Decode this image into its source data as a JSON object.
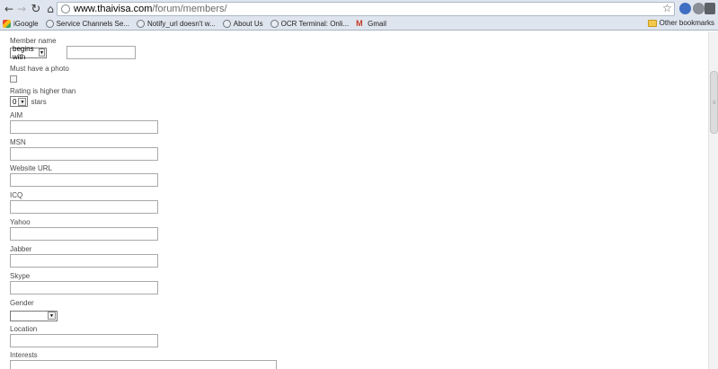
{
  "browser": {
    "url_host": "www.thaivisa.com",
    "url_path": "/forum/members/",
    "bookmarks": [
      {
        "label": "iGoogle",
        "icon": "google-icon"
      },
      {
        "label": "Service Channels Se...",
        "icon": "globe-icon"
      },
      {
        "label": "Notify_url doesn't w...",
        "icon": "globe-icon"
      },
      {
        "label": "About Us",
        "icon": "globe-icon"
      },
      {
        "label": "OCR Terminal: Onli...",
        "icon": "globe-icon"
      },
      {
        "label": "Gmail",
        "icon": "gmail-icon"
      }
    ],
    "other_bookmarks": "Other bookmarks"
  },
  "form": {
    "member_name": {
      "label": "Member name",
      "match_value": "begins with",
      "value": ""
    },
    "photo": {
      "label": "Must have a photo"
    },
    "rating": {
      "label": "Rating is higher than",
      "value": "0",
      "suffix": "stars"
    },
    "aim": {
      "label": "AIM"
    },
    "msn": {
      "label": "MSN"
    },
    "website": {
      "label": "Website URL"
    },
    "icq": {
      "label": "ICQ"
    },
    "yahoo": {
      "label": "Yahoo"
    },
    "jabber": {
      "label": "Jabber"
    },
    "skype": {
      "label": "Skype"
    },
    "gender": {
      "label": "Gender",
      "value": ""
    },
    "location": {
      "label": "Location"
    },
    "interests": {
      "label": "Interests"
    }
  }
}
